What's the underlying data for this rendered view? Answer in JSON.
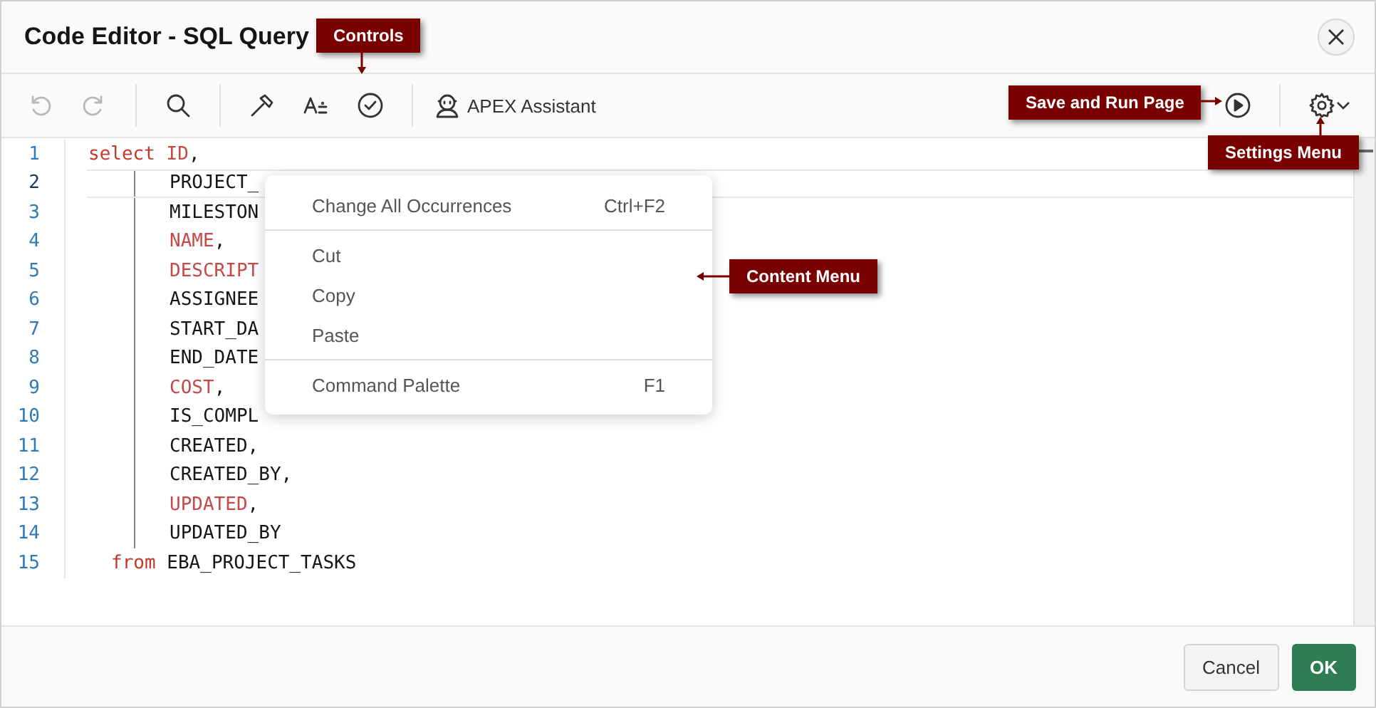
{
  "dialog": {
    "title": "Code Editor - SQL Query"
  },
  "toolbar": {
    "buttons": [
      {
        "kind": "undo",
        "disabled": true
      },
      {
        "kind": "redo",
        "disabled": true
      },
      {
        "kind": "sep"
      },
      {
        "kind": "search",
        "disabled": false
      },
      {
        "kind": "sep"
      },
      {
        "kind": "hammer",
        "disabled": false
      },
      {
        "kind": "format",
        "disabled": false
      },
      {
        "kind": "validate",
        "disabled": false
      },
      {
        "kind": "sep"
      }
    ],
    "assistant": "APEX Assistant"
  },
  "editor": {
    "lines": [
      {
        "number": "1",
        "active": false,
        "kind": "select",
        "tokens": [
          {
            "kind": "keyword",
            "text": "select"
          },
          {
            "kind": "name",
            "text": "ID"
          },
          {
            "kind": "plain",
            "text": ","
          }
        ]
      },
      {
        "number": "2",
        "active": true,
        "kind": "column",
        "tokens": [
          {
            "kind": "plain",
            "text": "PROJECT_"
          }
        ]
      },
      {
        "number": "3",
        "active": false,
        "kind": "column",
        "tokens": [
          {
            "kind": "plain",
            "text": "MILESTON"
          }
        ]
      },
      {
        "number": "4",
        "active": false,
        "kind": "column",
        "tokens": [
          {
            "kind": "name",
            "text": "NAME"
          },
          {
            "kind": "plain",
            "text": ","
          }
        ]
      },
      {
        "number": "5",
        "active": false,
        "kind": "column",
        "tokens": [
          {
            "kind": "name",
            "text": "DESCRIPT"
          }
        ]
      },
      {
        "number": "6",
        "active": false,
        "kind": "column",
        "tokens": [
          {
            "kind": "plain",
            "text": "ASSIGNEE"
          }
        ]
      },
      {
        "number": "7",
        "active": false,
        "kind": "column",
        "tokens": [
          {
            "kind": "plain",
            "text": "START_DA"
          }
        ]
      },
      {
        "number": "8",
        "active": false,
        "kind": "column",
        "tokens": [
          {
            "kind": "plain",
            "text": "END_DATE"
          }
        ]
      },
      {
        "number": "9",
        "active": false,
        "kind": "column",
        "tokens": [
          {
            "kind": "name",
            "text": "COST"
          },
          {
            "kind": "plain",
            "text": ","
          }
        ]
      },
      {
        "number": "10",
        "active": false,
        "kind": "column",
        "tokens": [
          {
            "kind": "plain",
            "text": "IS_COMPL"
          }
        ]
      },
      {
        "number": "11",
        "active": false,
        "kind": "column",
        "tokens": [
          {
            "kind": "plain",
            "text": "CREATED,"
          }
        ]
      },
      {
        "number": "12",
        "active": false,
        "kind": "column",
        "tokens": [
          {
            "kind": "plain",
            "text": "CREATED_BY,"
          }
        ]
      },
      {
        "number": "13",
        "active": false,
        "kind": "column",
        "tokens": [
          {
            "kind": "name",
            "text": "UPDATED"
          },
          {
            "kind": "plain",
            "text": ","
          }
        ]
      },
      {
        "number": "14",
        "active": false,
        "kind": "column",
        "tokens": [
          {
            "kind": "plain",
            "text": "UPDATED_BY"
          }
        ]
      },
      {
        "number": "15",
        "active": false,
        "kind": "from",
        "tokens": [
          {
            "kind": "keyword",
            "text": "from"
          },
          {
            "kind": "plain",
            "text": "EBA_PROJECT_TASKS"
          }
        ]
      }
    ]
  },
  "context_menu": {
    "groups": [
      [
        {
          "label": "Change All Occurrences",
          "shortcut": "Ctrl+F2"
        }
      ],
      [
        {
          "label": "Cut"
        },
        {
          "label": "Copy"
        },
        {
          "label": "Paste"
        }
      ],
      [
        {
          "label": "Command Palette",
          "shortcut": "F1"
        }
      ]
    ]
  },
  "callouts": [
    {
      "kind": "controls",
      "text": "Controls"
    },
    {
      "kind": "run",
      "text": "Save and Run Page"
    },
    {
      "kind": "settings",
      "text": "Settings Menu"
    },
    {
      "kind": "menu",
      "text": "Content Menu"
    }
  ],
  "footer": {
    "cancel": "Cancel",
    "ok": "OK"
  }
}
